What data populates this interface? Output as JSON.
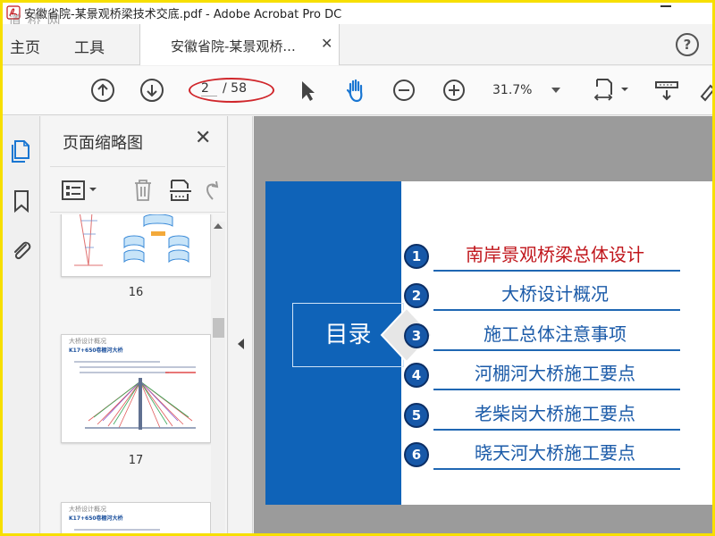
{
  "window": {
    "title": "安徽省院-某景观桥梁技术交底.pdf - Adobe Acrobat Pro DC",
    "watermark": "道 桥 网"
  },
  "tabs": {
    "home": "主页",
    "tools": "工具",
    "document": "安徽省院-某景观桥...",
    "close_glyph": "✕",
    "help_glyph": "?"
  },
  "toolbar": {
    "current_page": "2",
    "total_pages": "/ 58",
    "zoom": "31.7%",
    "icons": [
      "prev-page-icon",
      "next-page-icon",
      "select-cursor-icon",
      "hand-tool-icon",
      "zoom-out-icon",
      "zoom-in-icon",
      "page-fit-icon",
      "scroll-mode-icon",
      "sign-icon"
    ]
  },
  "left_rail": {
    "icons": [
      "page-thumbnails-icon",
      "bookmarks-icon",
      "attachments-icon"
    ]
  },
  "panel": {
    "title": "页面缩略图",
    "close_glyph": "✕",
    "thumbnails": [
      {
        "label": "16"
      },
      {
        "label": "17",
        "heading": "大桥设计概况",
        "subheading": "K17+650卷棚河大桥"
      },
      {
        "heading": "大桥设计概况",
        "subheading": "K17+650卷棚河大桥"
      }
    ]
  },
  "document": {
    "toc_label": "目录",
    "items": [
      {
        "num": "1",
        "text": "南岸景观桥梁总体设计",
        "highlight": true
      },
      {
        "num": "2",
        "text": "大桥设计概况",
        "highlight": false
      },
      {
        "num": "3",
        "text": "施工总体注意事项",
        "highlight": false
      },
      {
        "num": "4",
        "text": "河棚河大桥施工要点",
        "highlight": false
      },
      {
        "num": "5",
        "text": "老柴岗大桥施工要点",
        "highlight": false
      },
      {
        "num": "6",
        "text": "晓天河大桥施工要点",
        "highlight": false
      }
    ]
  },
  "colors": {
    "desktop_border": "#f7df00",
    "page_blue": "#0f63b8",
    "toc_text": "#1a5aa8",
    "highlight_text": "#c0151b",
    "annotation_red": "#d0262b"
  }
}
